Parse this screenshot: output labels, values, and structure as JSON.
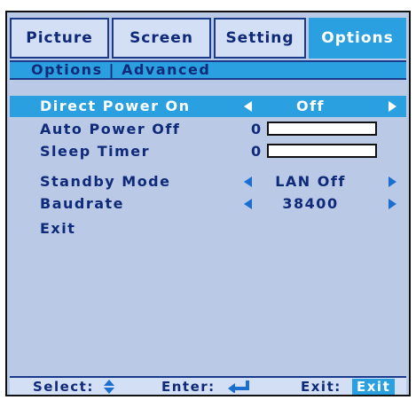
{
  "tabs": [
    {
      "label": "Picture",
      "active": false
    },
    {
      "label": "Screen",
      "active": false
    },
    {
      "label": "Setting",
      "active": false
    },
    {
      "label": "Options",
      "active": true
    }
  ],
  "section_title": "Options | Advanced",
  "menu": [
    {
      "label": "Direct Power On",
      "value": "Off",
      "type": "select",
      "selected": true
    },
    {
      "label": "Auto Power Off",
      "value": "0",
      "type": "slider",
      "level": 0
    },
    {
      "label": "Sleep Timer",
      "value": "0",
      "type": "slider",
      "level": 0
    },
    {
      "label": "Standby Mode",
      "value": "LAN Off",
      "type": "select"
    },
    {
      "label": "Baudrate",
      "value": "38400",
      "type": "select"
    },
    {
      "label": "Exit",
      "type": "action"
    }
  ],
  "footer": {
    "select_label": "Select:",
    "enter_label": "Enter:",
    "exit_label": "Exit:",
    "exit_key": "Exit"
  },
  "colors": {
    "panel": "#b9c9e6",
    "highlight": "#2aa0e0",
    "text": "#102a7a",
    "arrow": "#1a6fd0"
  },
  "icons": [
    "left-arrow-icon",
    "right-arrow-icon",
    "up-down-icon",
    "enter-icon"
  ]
}
